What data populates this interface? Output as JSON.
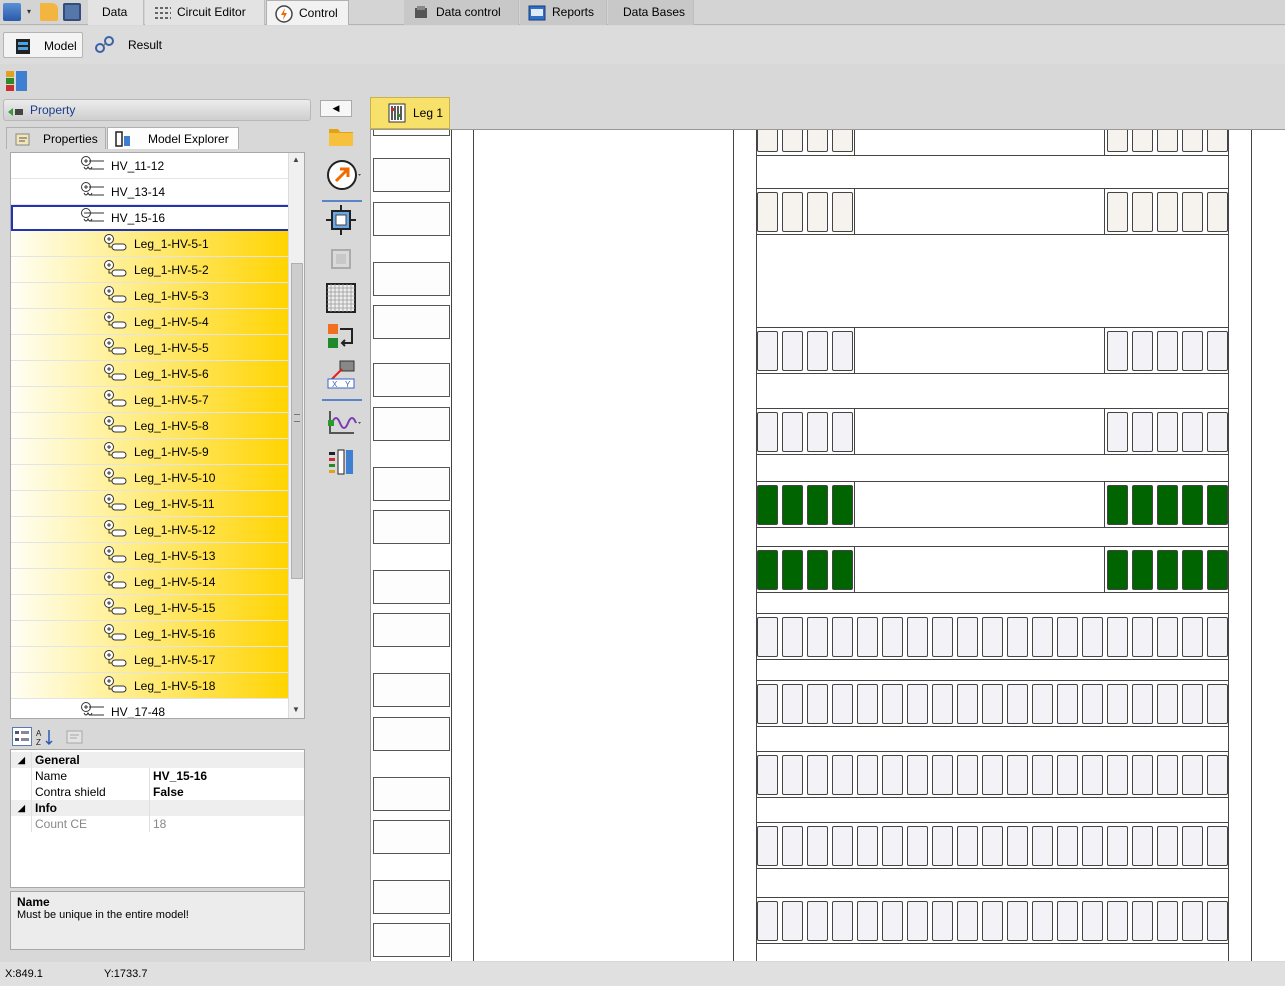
{
  "menu": {
    "tabs": [
      {
        "label": "Data"
      },
      {
        "label": "Circuit Editor"
      },
      {
        "label": "Control"
      },
      {
        "label": "Data control"
      },
      {
        "label": "Reports"
      },
      {
        "label": "Data Bases"
      }
    ]
  },
  "subtoolbar": {
    "model_label": "Model",
    "result_label": "Result"
  },
  "property_panel": {
    "header": "Property",
    "tabs": [
      {
        "label": "Properties"
      },
      {
        "label": "Model Explorer"
      }
    ]
  },
  "tree": {
    "items": [
      {
        "label": "HV_11-12"
      },
      {
        "label": "HV_13-14"
      },
      {
        "label": "HV_15-16"
      },
      {
        "label": "Leg_1-HV-5-1"
      },
      {
        "label": "Leg_1-HV-5-2"
      },
      {
        "label": "Leg_1-HV-5-3"
      },
      {
        "label": "Leg_1-HV-5-4"
      },
      {
        "label": "Leg_1-HV-5-5"
      },
      {
        "label": "Leg_1-HV-5-6"
      },
      {
        "label": "Leg_1-HV-5-7"
      },
      {
        "label": "Leg_1-HV-5-8"
      },
      {
        "label": "Leg_1-HV-5-9"
      },
      {
        "label": "Leg_1-HV-5-10"
      },
      {
        "label": "Leg_1-HV-5-11"
      },
      {
        "label": "Leg_1-HV-5-12"
      },
      {
        "label": "Leg_1-HV-5-13"
      },
      {
        "label": "Leg_1-HV-5-14"
      },
      {
        "label": "Leg_1-HV-5-15"
      },
      {
        "label": "Leg_1-HV-5-16"
      },
      {
        "label": "Leg_1-HV-5-17"
      },
      {
        "label": "Leg_1-HV-5-18"
      },
      {
        "label": "HV_17-48"
      }
    ]
  },
  "property_grid": {
    "general_label": "General",
    "name_label": "Name",
    "name_value": "HV_15-16",
    "contra_label": "Contra shield",
    "contra_value": "False",
    "info_label": "Info",
    "count_label": "Count CE",
    "count_value": "18"
  },
  "help": {
    "title": "Name",
    "text": "Must be unique in the entire model!"
  },
  "document_tab": {
    "label": "Leg 1"
  },
  "status": {
    "x": "X:849.1",
    "y": "Y:1733.7"
  },
  "colors": {
    "cell_green": "#006400",
    "selection_yellow": "#ffd400",
    "focus_border": "#2034b4"
  }
}
